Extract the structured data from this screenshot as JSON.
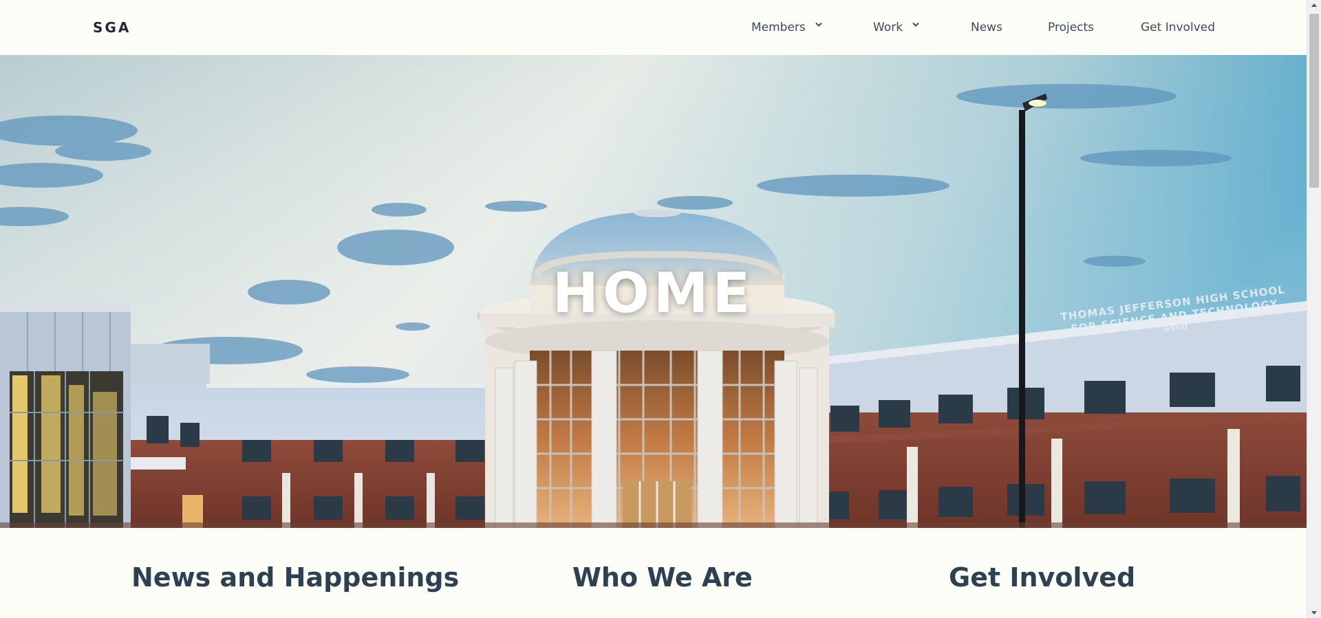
{
  "navbar": {
    "brand": "SGA",
    "items": [
      {
        "label": "Members",
        "has_dropdown": true
      },
      {
        "label": "Work",
        "has_dropdown": true
      },
      {
        "label": "News",
        "has_dropdown": false
      },
      {
        "label": "Projects",
        "has_dropdown": false
      },
      {
        "label": "Get Involved",
        "has_dropdown": false
      }
    ]
  },
  "hero": {
    "title": "HOME",
    "sign_line1": "THOMAS JEFFERSON HIGH SCHOOL",
    "sign_line2": "FOR SCIENCE AND TECHNOLOGY",
    "sign_number": "6560"
  },
  "sections": [
    {
      "heading": "News and Happenings"
    },
    {
      "heading": "Who We Are"
    },
    {
      "heading": "Get Involved"
    }
  ],
  "colors": {
    "background": "#fdfdf8",
    "heading": "#2d4152",
    "nav_text": "#3a4a5a",
    "hero_title": "#ffffff"
  },
  "icons": {
    "dropdown": "chevron-down-icon"
  }
}
